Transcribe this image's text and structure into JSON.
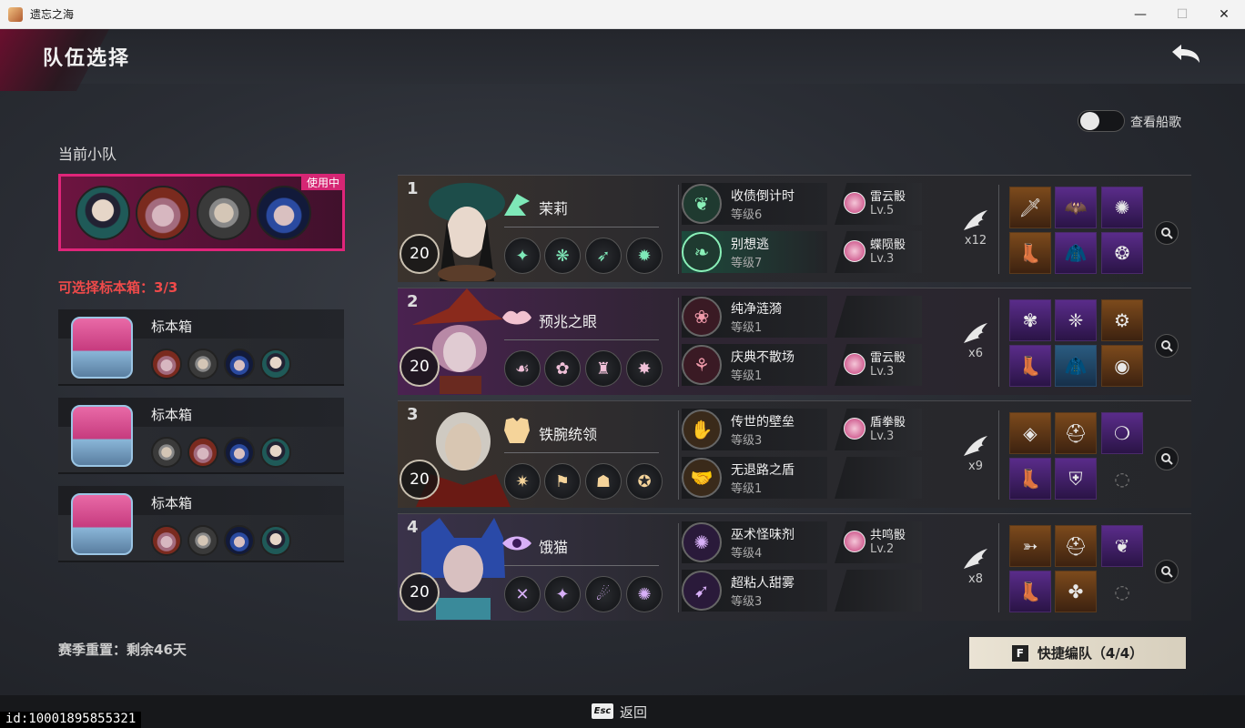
{
  "window": {
    "title": "遗忘之海",
    "min": "—",
    "max": "☐",
    "close": "✕"
  },
  "header": {
    "title": "队伍选择"
  },
  "toggle": {
    "label": "查看船歌",
    "on": false
  },
  "current_team": {
    "label": "当前小队",
    "badge": "使用中"
  },
  "selectable": {
    "label": "可选择标本箱：3/3"
  },
  "boxes": [
    {
      "name": "标本箱"
    },
    {
      "name": "标本箱"
    },
    {
      "name": "标本箱"
    }
  ],
  "season": {
    "text": "赛季重置：剩余46天"
  },
  "rows": [
    {
      "index": "1",
      "level": "20",
      "name": "茉莉",
      "relics": [
        {
          "name": "收债倒计时",
          "level": "等级6",
          "dice": "雷云骰",
          "dice_lvl": "Lv.5"
        },
        {
          "name": "别想逃",
          "level": "等级7",
          "dice": "蝶陨骰",
          "dice_lvl": "Lv.3"
        }
      ],
      "wing_count": "x12"
    },
    {
      "index": "2",
      "level": "20",
      "name": "预兆之眼",
      "relics": [
        {
          "name": "纯净涟漪",
          "level": "等级1",
          "dice": "",
          "dice_lvl": ""
        },
        {
          "name": "庆典不散场",
          "level": "等级1",
          "dice": "雷云骰",
          "dice_lvl": "Lv.3"
        }
      ],
      "wing_count": "x6"
    },
    {
      "index": "3",
      "level": "20",
      "name": "铁腕统领",
      "relics": [
        {
          "name": "传世的壁垒",
          "level": "等级3",
          "dice": "盾拳骰",
          "dice_lvl": "Lv.3"
        },
        {
          "name": "无退路之盾",
          "level": "等级1",
          "dice": "",
          "dice_lvl": ""
        }
      ],
      "wing_count": "x9"
    },
    {
      "index": "4",
      "level": "20",
      "name": "饿猫",
      "relics": [
        {
          "name": "巫术怪味剂",
          "level": "等级4",
          "dice": "共鸣骰",
          "dice_lvl": "Lv.2"
        },
        {
          "name": "超粘人甜雾",
          "level": "等级3",
          "dice": "",
          "dice_lvl": ""
        }
      ],
      "wing_count": "x8"
    }
  ],
  "quick_button": {
    "key": "F",
    "label": "快捷编队（4/4）"
  },
  "footer": {
    "esc_key": "Esc",
    "back_label": "返回"
  },
  "uid": "id:10001895855321",
  "colors": {
    "accent_pink": "#e0257a",
    "warning_red": "#ef4a4a",
    "dice_pink": "#c43a78"
  }
}
